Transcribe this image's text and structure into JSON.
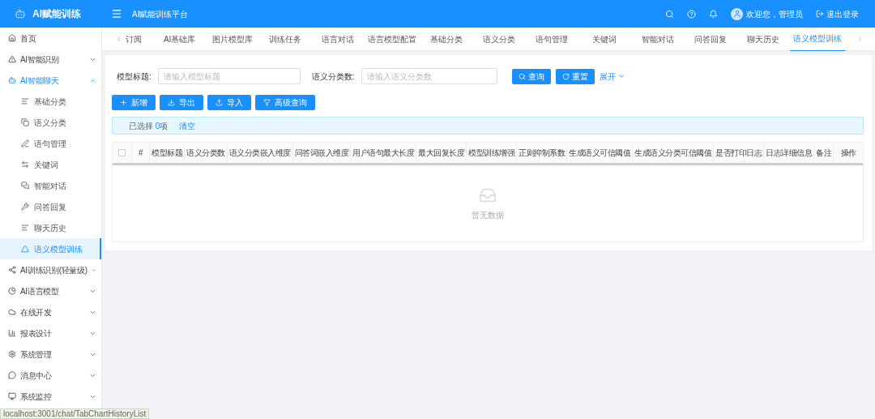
{
  "header": {
    "app_name": "AI赋能训练",
    "platform_title": "AI赋能训练平台",
    "user": "欢迎您，管理员",
    "logout": "退出登录"
  },
  "sidebar": {
    "items": [
      {
        "label": "首页",
        "selected": false
      },
      {
        "label": "AI智能识别",
        "expanded": false,
        "selected": false
      },
      {
        "label": "AI智能聊天",
        "expanded": true,
        "selected": true,
        "children": [
          {
            "label": "基础分类",
            "selected": false
          },
          {
            "label": "语义分类",
            "selected": false
          },
          {
            "label": "语句管理",
            "selected": false
          },
          {
            "label": "关键词",
            "selected": false
          },
          {
            "label": "智能对话",
            "selected": false
          },
          {
            "label": "问答回复",
            "selected": false
          },
          {
            "label": "聊天历史",
            "selected": false
          },
          {
            "label": "语义模型训练",
            "selected": true
          }
        ]
      },
      {
        "label": "AI训练识别(轻量级)",
        "expanded": false,
        "selected": false
      },
      {
        "label": "AI语言模型",
        "expanded": false,
        "selected": false
      },
      {
        "label": "在线开发",
        "expanded": false,
        "selected": false
      },
      {
        "label": "报表设计",
        "expanded": false,
        "selected": false
      },
      {
        "label": "系统管理",
        "expanded": false,
        "selected": false
      },
      {
        "label": "消息中心",
        "expanded": false,
        "selected": false
      },
      {
        "label": "系统监控",
        "expanded": false,
        "selected": false
      }
    ]
  },
  "tabs": [
    {
      "label": "订阅",
      "selected": false
    },
    {
      "label": "AI基础库",
      "selected": false
    },
    {
      "label": "图片模型库",
      "selected": false
    },
    {
      "label": "训练任务",
      "selected": false
    },
    {
      "label": "语言对话",
      "selected": false
    },
    {
      "label": "语言模型配置",
      "selected": false
    },
    {
      "label": "基础分类",
      "selected": false
    },
    {
      "label": "语义分类",
      "selected": false
    },
    {
      "label": "语句管理",
      "selected": false
    },
    {
      "label": "关键词",
      "selected": false
    },
    {
      "label": "智能对话",
      "selected": false
    },
    {
      "label": "问答回复",
      "selected": false
    },
    {
      "label": "聊天历史",
      "selected": false
    },
    {
      "label": "语义模型训练",
      "selected": true
    }
  ],
  "search": {
    "fields": [
      {
        "label": "模型标题:",
        "placeholder": "请输入模型标题"
      },
      {
        "label": "语义分类数:",
        "placeholder": "请输入语义分类数"
      }
    ],
    "buttons": [
      "查询",
      "重置"
    ],
    "expand": "展开"
  },
  "toolbar": [
    "新增",
    "导出",
    "导入",
    "高级查询"
  ],
  "selection": {
    "prefix": "已选择 ",
    "count": "0",
    "suffix": "项",
    "clear": "清空"
  },
  "table": {
    "columns": [
      "#",
      "模型标题",
      "语义分类数",
      "语义分类嵌入维度",
      "问答词嵌入维度",
      "用户语句最大长度",
      "最大回复长度",
      "模型训练增强",
      "正则抑制系数",
      "生成语义可信阈值",
      "生成语义分类可信阈值",
      "是否打印日志",
      "日志详细信息",
      "备注"
    ],
    "action_column": "操作",
    "select_all": {
      "checked": false
    },
    "empty_text": "暂无数据"
  },
  "status_url": "localhost:3001/chat/TabChartHistoryList"
}
